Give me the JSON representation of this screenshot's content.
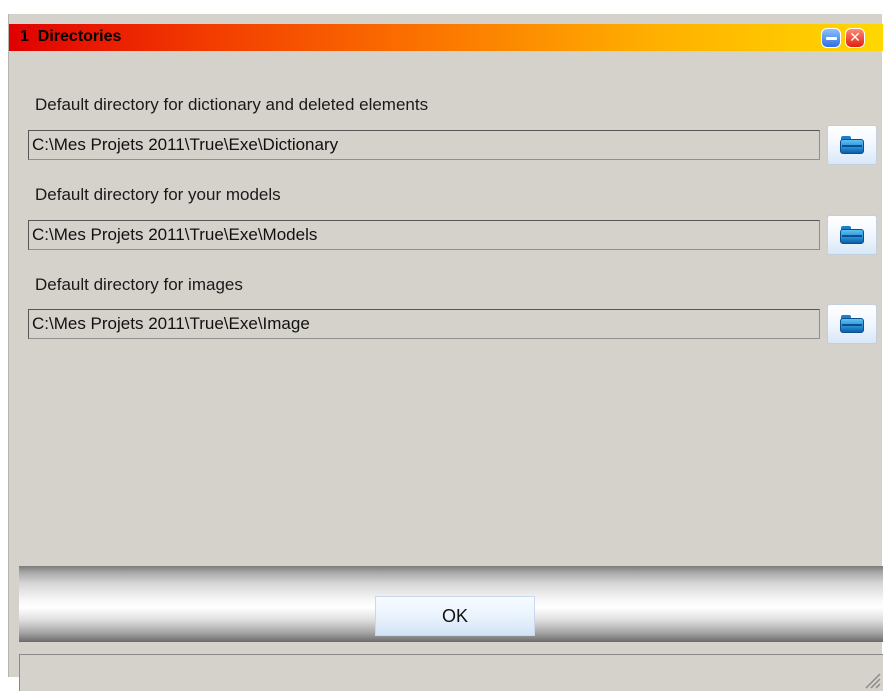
{
  "window": {
    "title": "1  Directories",
    "minimize_icon": "minimize-icon",
    "close_icon": "close-icon"
  },
  "directories": [
    {
      "label": "Default directory for dictionary and deleted elements",
      "path": "C:\\Mes Projets 2011\\True\\Exe\\Dictionary",
      "browse_icon": "folder-icon"
    },
    {
      "label": "Default directory for your models",
      "path": "C:\\Mes Projets 2011\\True\\Exe\\Models",
      "browse_icon": "folder-icon"
    },
    {
      "label": "Default directory for images",
      "path": "C:\\Mes Projets 2011\\True\\Exe\\Image",
      "browse_icon": "folder-icon"
    }
  ],
  "footer": {
    "ok_label": "OK",
    "status_text": ""
  },
  "colors": {
    "title_gradient_start": "#e00000",
    "title_gradient_end": "#ffd800",
    "window_bg": "#d5d1cb"
  }
}
